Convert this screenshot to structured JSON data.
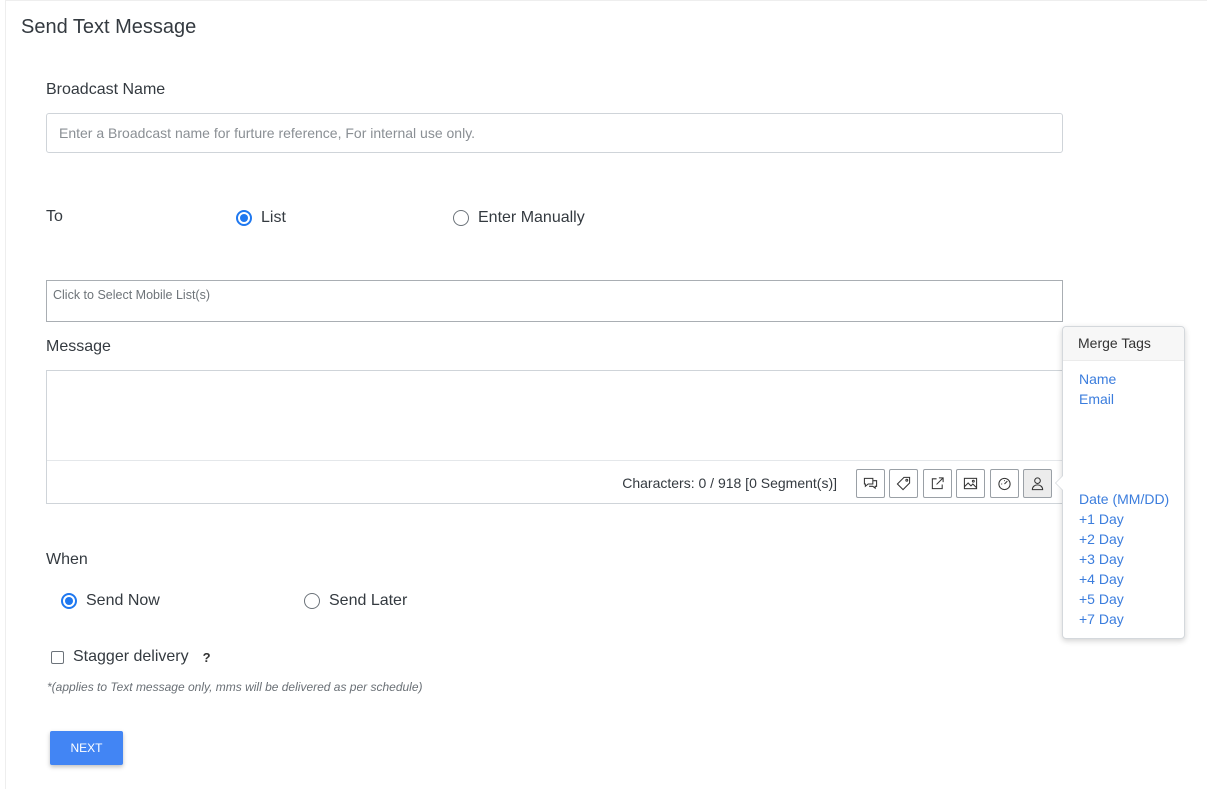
{
  "page": {
    "title": "Send Text Message"
  },
  "broadcast": {
    "label": "Broadcast Name",
    "placeholder": "Enter a Broadcast name for furture reference, For internal use only.",
    "value": ""
  },
  "to": {
    "label": "To",
    "options": [
      {
        "label": "List",
        "selected": true
      },
      {
        "label": "Enter Manually",
        "selected": false
      }
    ],
    "list_placeholder": "Click to Select Mobile List(s)"
  },
  "message": {
    "label": "Message",
    "value": "",
    "char_count": "Characters: 0 / 918 [0 Segment(s)]",
    "toolbar_icons": [
      "chat-icon",
      "tag-icon",
      "external-link-icon",
      "image-icon",
      "speedometer-icon",
      "person-icon"
    ]
  },
  "merge_tags": {
    "title": "Merge Tags",
    "items": [
      "Name",
      "Email",
      "Date (MM/DD)",
      "+1 Day",
      "+2 Day",
      "+3 Day",
      "+4 Day",
      "+5 Day",
      "+7 Day"
    ]
  },
  "when": {
    "label": "When",
    "options": [
      {
        "label": "Send Now",
        "selected": true
      },
      {
        "label": "Send Later",
        "selected": false
      }
    ]
  },
  "stagger": {
    "label": "Stagger delivery",
    "checked": false,
    "help_icon": "question-icon",
    "note": "*(applies to Text message only, mms will be delivered as per schedule)"
  },
  "actions": {
    "next_label": "NEXT"
  },
  "colors": {
    "accent": "#1f78f0",
    "link": "#3b7ddd",
    "button": "#4285f4"
  }
}
